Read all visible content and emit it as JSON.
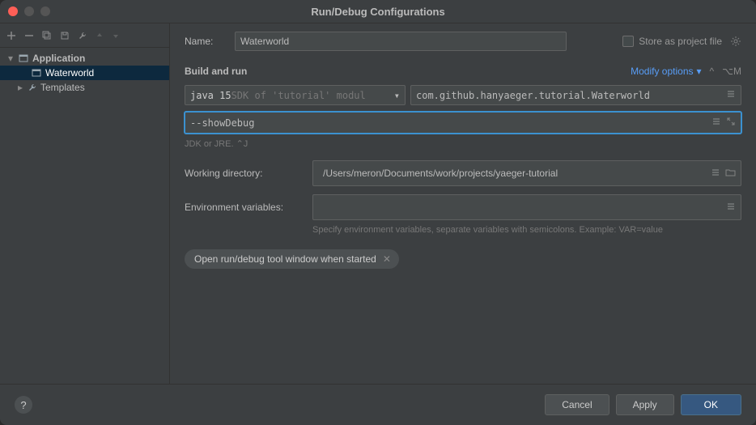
{
  "window": {
    "title": "Run/Debug Configurations"
  },
  "sidebar": {
    "items": [
      {
        "label": "Application",
        "expanded": true
      },
      {
        "label": "Waterworld",
        "selected": true
      },
      {
        "label": "Templates",
        "expanded": false
      }
    ]
  },
  "form": {
    "name_label": "Name:",
    "name_value": "Waterworld",
    "store_label": "Store as project file",
    "section_title": "Build and run",
    "modify_options_label": "Modify options",
    "modify_options_shortcut": "⌥M",
    "jdk_prefix": "java 15",
    "jdk_suffix": " SDK of 'tutorial' modul",
    "main_class": "com.github.hanyaeger.tutorial.Waterworld",
    "program_args": "--showDebug",
    "jdk_hint": "JDK or JRE. ⌃J",
    "working_dir_label": "Working directory:",
    "working_dir_value": "/Users/meron/Documents/work/projects/yaeger-tutorial",
    "env_label": "Environment variables:",
    "env_value": "",
    "env_hint": "Specify environment variables, separate variables with semicolons. Example: VAR=value",
    "chip_label": "Open run/debug tool window when started"
  },
  "footer": {
    "help": "?",
    "cancel": "Cancel",
    "apply": "Apply",
    "ok": "OK"
  }
}
